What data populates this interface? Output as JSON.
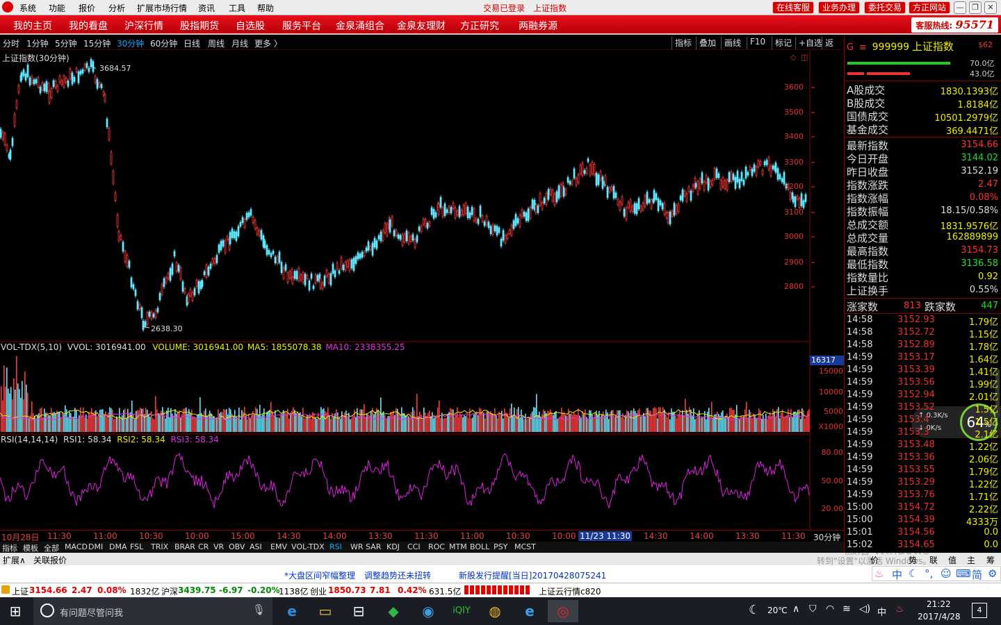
{
  "menubar": {
    "items": [
      "系统",
      "功能",
      "报价",
      "分析",
      "扩展市场行情",
      "资讯",
      "工具",
      "帮助"
    ],
    "trade_status": "交易已登录",
    "current_index": "上证指数",
    "buttons": [
      "在线客服",
      "业务办理",
      "委托交易",
      "方正网站"
    ]
  },
  "navbar": {
    "items": [
      "我的主页",
      "我的看盘",
      "沪深行情",
      "股指期货",
      "自选股",
      "服务平台",
      "金泉涌组合",
      "金泉友理财",
      "方正研究",
      "两融券源"
    ],
    "hotline_label": "客服热线:",
    "hotline_number": "95571"
  },
  "periodbar": {
    "periods": [
      "分时",
      "1分钟",
      "5分钟",
      "15分钟",
      "30分钟",
      "60分钟",
      "日线",
      "周线",
      "月线",
      "更多 〉"
    ],
    "active": "30分钟",
    "tools": [
      "指标",
      "叠加",
      "画线",
      "F10",
      "标记",
      "+自选",
      "返回"
    ]
  },
  "main_chart": {
    "title": "上证指数(30分钟)",
    "high_label": "3684.57",
    "low_label": "2638.30",
    "y_ticks": [
      "3600",
      "3500",
      "3400",
      "3300",
      "3200",
      "3100",
      "3000",
      "2900",
      "2800"
    ]
  },
  "vol_panel": {
    "name": "VOL-TDX(5,10)",
    "vvol": "VVOL: 3016941.00",
    "volume": "VOLUME: 3016941.00",
    "ma5": "MA5: 1855078.38",
    "ma10": "MA10: 2338355.25",
    "cursor_value": "16317",
    "y_ticks": [
      "15000",
      "10000",
      "5000"
    ],
    "unit": "X1000"
  },
  "rsi_panel": {
    "name": "RSI(14,14,14)",
    "rsi1": "RSI1: 58.34",
    "rsi2": "RSI2: 58.34",
    "rsi3": "RSI3: 58.34",
    "y_ticks": [
      "80.00",
      "50.00",
      "20.00"
    ]
  },
  "xaxis": {
    "labels": [
      "10月28日",
      "11:30",
      "11:00",
      "10:30",
      "10:00",
      "15:00",
      "14:30",
      "14:00",
      "13:30",
      "11:30",
      "11:00",
      "10:30",
      "10:00",
      "11/23 11:30",
      "14:30",
      "14:00",
      "13:30",
      "11:30"
    ],
    "period": "30分钟"
  },
  "tabs": [
    "指标",
    "模板",
    "全部",
    "MACD",
    "DMI",
    "DMA",
    "FSL",
    "TRIX",
    "BRAR",
    "CR",
    "VR",
    "OBV",
    "ASI",
    "EMV",
    "VOL-TDX",
    "RSI",
    "WR",
    "SAR",
    "KDJ",
    "CCI",
    "ROC",
    "MTM",
    "BOLL",
    "PSY",
    "MCST"
  ],
  "active_tab": "RSI",
  "bottom_left": [
    "扩展∧",
    "关联报价"
  ],
  "bottom_right": [
    "价",
    "势",
    "联",
    "值",
    "主",
    "筹"
  ],
  "watermark": {
    "line1": "激活 Windows",
    "line2": "转到\"设置\"以激活 Windows。"
  },
  "right_panel": {
    "code": "999999",
    "name": "上证指数",
    "badge": "$62",
    "bar_values": [
      "70.0亿",
      "43.0亿"
    ],
    "turnover": [
      {
        "label": "A股成交",
        "value": "1830.1393亿"
      },
      {
        "label": "B股成交",
        "value": "1.8184亿"
      },
      {
        "label": "国债成交",
        "value": "10501.2979亿"
      },
      {
        "label": "基金成交",
        "value": "369.4471亿"
      }
    ],
    "quote": [
      {
        "label": "最新指数",
        "value": "3154.66",
        "color": "#ff3030"
      },
      {
        "label": "今日开盘",
        "value": "3144.02",
        "color": "#22dd22"
      },
      {
        "label": "昨日收盘",
        "value": "3152.19",
        "color": "#dddddd"
      },
      {
        "label": "指数涨跌",
        "value": "2.47",
        "color": "#ff3030"
      },
      {
        "label": "指数涨幅",
        "value": "0.08%",
        "color": "#ff3030"
      },
      {
        "label": "指数振幅",
        "value": "18.15/0.58%",
        "color": "#dddddd"
      },
      {
        "label": "总成交额",
        "value": "1831.9576亿",
        "color": "#eeee00"
      },
      {
        "label": "总成交量",
        "value": "162889899",
        "color": "#eeee00"
      },
      {
        "label": "最高指数",
        "value": "3154.73",
        "color": "#ff3030"
      },
      {
        "label": "最低指数",
        "value": "3136.58",
        "color": "#22dd22"
      },
      {
        "label": "指数量比",
        "value": "0.92",
        "color": "#eeee00"
      },
      {
        "label": "上证换手",
        "value": "0.55%",
        "color": "#dddddd"
      }
    ],
    "up_label": "涨家数",
    "up_count": "813",
    "down_label": "跌家数",
    "down_count": "447",
    "ticks": [
      {
        "time": "14:58",
        "price": "3152.93",
        "amt": "1.79亿"
      },
      {
        "time": "14:58",
        "price": "3152.72",
        "amt": "1.15亿"
      },
      {
        "time": "14:58",
        "price": "3152.89",
        "amt": "1.78亿"
      },
      {
        "time": "14:59",
        "price": "3153.17",
        "amt": "1.64亿"
      },
      {
        "time": "14:59",
        "price": "3153.39",
        "amt": "1.41亿"
      },
      {
        "time": "14:59",
        "price": "3153.56",
        "amt": "1.99亿"
      },
      {
        "time": "14:59",
        "price": "3152.94",
        "amt": "2.01亿"
      },
      {
        "time": "14:59",
        "price": "3153.52",
        "amt": "1.5亿"
      },
      {
        "time": "14:59",
        "price": "3153.4",
        "amt": "1.5亿"
      },
      {
        "time": "14:59",
        "price": "3153.3",
        "amt": "2.1亿"
      },
      {
        "time": "14:59",
        "price": "3153.48",
        "amt": "1.22亿"
      },
      {
        "time": "14:59",
        "price": "3153.36",
        "amt": "2.06亿"
      },
      {
        "time": "14:59",
        "price": "3153.55",
        "amt": "1.79亿"
      },
      {
        "time": "14:59",
        "price": "3153.29",
        "amt": "1.22亿"
      },
      {
        "time": "14:59",
        "price": "3153.76",
        "amt": "1.71亿"
      },
      {
        "time": "15:00",
        "price": "3154.72",
        "amt": "2.22亿"
      },
      {
        "time": "15:00",
        "price": "3154.39",
        "amt": "4333万"
      },
      {
        "time": "15:01",
        "price": "3154.56",
        "amt": "0.0"
      },
      {
        "time": "15:02",
        "price": "3154.65",
        "amt": "0.0"
      }
    ],
    "net_widget": {
      "up": "0.3K/s",
      "down": "0K/s",
      "percent": "64",
      "percent_sign": "%"
    }
  },
  "newsbar": [
    "*大盘区间窄幅整理",
    "调整趋势还未扭转",
    "新股发行提醒[当日]20170428075241"
  ],
  "index_bar": {
    "sh": {
      "name": "上证",
      "value": "3154.66",
      "chg": "2.47",
      "pct": "0.08%",
      "amt": "1832亿"
    },
    "hs": {
      "name": "沪深",
      "value": "3439.75",
      "chg": "-6.97",
      "pct": "-0.20%",
      "amt": "1138亿"
    },
    "cy": {
      "name": "创业",
      "value": "1850.73",
      "chg": "7.81",
      "pct": "0.42%",
      "amt": "631.5亿"
    },
    "cloud": "上证云行情c820"
  },
  "ime": [
    "中",
    "简"
  ],
  "taskbar": {
    "search_placeholder": "有问题尽管问我",
    "weather": "20℃",
    "ime": "中",
    "time": "21:22",
    "date": "2017/4/28",
    "notif": "4"
  }
}
